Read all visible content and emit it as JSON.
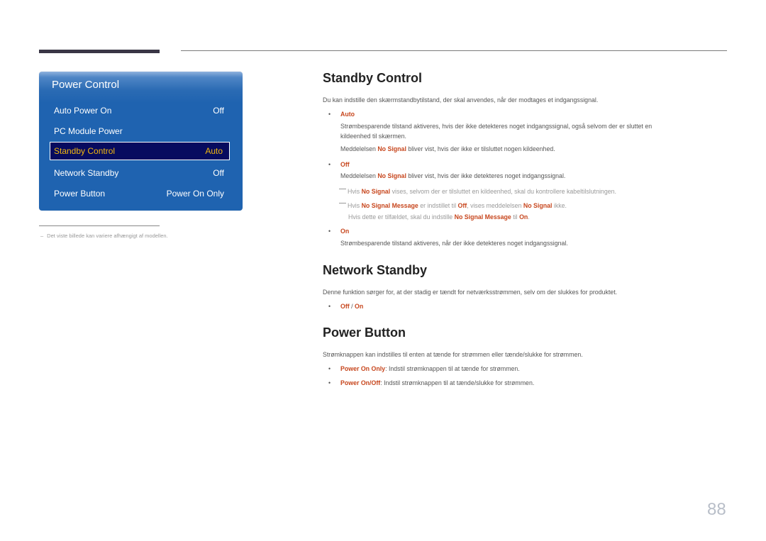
{
  "osd": {
    "title": "Power Control",
    "items": [
      {
        "label": "Auto Power On",
        "value": "Off"
      },
      {
        "label": "PC Module Power",
        "value": ""
      },
      {
        "label": "Standby Control",
        "value": "Auto"
      },
      {
        "label": "Network Standby",
        "value": "Off"
      },
      {
        "label": "Power Button",
        "value": "Power On Only"
      }
    ],
    "selected_index": 2
  },
  "footnote": {
    "dash": "–",
    "text": "Det viste billede kan variere afhængigt af modellen."
  },
  "standby": {
    "heading": "Standby Control",
    "intro": "Du kan indstille den skærmstandbytilstand, der skal anvendes, når der modtages et indgangssignal.",
    "auto": {
      "label": "Auto",
      "line1": "Strømbesparende tilstand aktiveres, hvis der ikke detekteres noget indgangssignal, også selvom der er sluttet en",
      "line2": "kildeenhed til skærmen.",
      "msg_pre": "Meddelelsen ",
      "msg_hl": "No Signal",
      "msg_post": " bliver vist, hvis der ikke er tilsluttet nogen kildeenhed."
    },
    "off": {
      "label": "Off",
      "msg_pre": "Meddelelsen ",
      "msg_hl": "No Signal",
      "msg_post": " bliver vist, hvis der ikke detekteres noget indgangssignal.",
      "note1": {
        "pre": "Hvis ",
        "hl": "No Signal",
        "post": " vises, selvom der er tilsluttet en kildeenhed, skal du kontrollere kabeltilslutningen."
      },
      "note2": {
        "pre": "Hvis ",
        "hl1": "No Signal Message",
        "mid1": " er indstillet til ",
        "hl2": "Off",
        "mid2": ", vises meddelelsen ",
        "hl3": "No Signal",
        "post": " ikke."
      },
      "note3": {
        "pre": "Hvis dette er tilfældet, skal du indstille ",
        "hl1": "No Signal Message",
        "mid": " til ",
        "hl2": "On",
        "post": "."
      }
    },
    "on": {
      "label": "On",
      "text": "Strømbesparende tilstand aktiveres, når der ikke detekteres noget indgangssignal."
    }
  },
  "network": {
    "heading": "Network Standby",
    "intro": "Denne funktion sørger for, at der stadig er tændt for netværksstrømmen, selv om der slukkes for produktet.",
    "opt1": "Off",
    "sep": " / ",
    "opt2": "On"
  },
  "powerbtn": {
    "heading": "Power Button",
    "intro": "Strømknappen kan indstilles til enten at tænde for strømmen eller tænde/slukke for strømmen.",
    "items": [
      {
        "label": "Power On Only",
        "text": ": Indstil strømknappen til at tænde for strømmen."
      },
      {
        "label": "Power On/Off",
        "text": ": Indstil strømknappen til at tænde/slukke for strømmen."
      }
    ]
  },
  "bullet": "•",
  "page_number": "88"
}
